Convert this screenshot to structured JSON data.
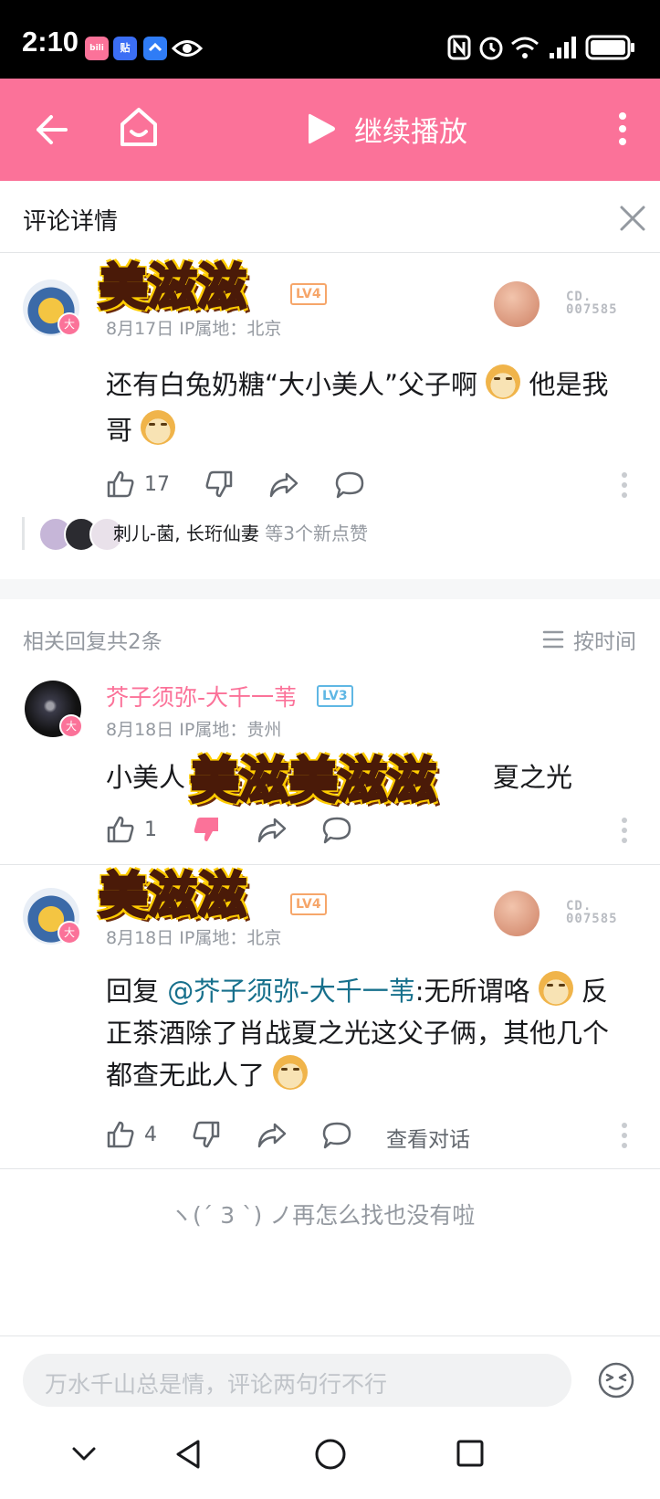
{
  "status_bar": {
    "time": "2:10",
    "apps": [
      "bilibili",
      "贴",
      "app-icon",
      "eye-icon"
    ]
  },
  "top_nav": {
    "continue_label": "继续播放"
  },
  "header": {
    "title": "评论详情"
  },
  "main_comment": {
    "username": "美滋滋",
    "level": "LV4",
    "meta": "8月17日  IP属地：北京",
    "text_1": "还有白兔奶糖“大小美人”父子啊",
    "text_2": "他是我",
    "text_3": "哥",
    "likes": "17",
    "liked_by": "刺儿-菌, 长珩仙妻",
    "liked_suffix": "等3个新点赞",
    "fan_badge_code_1": "CD.",
    "fan_badge_code_2": "007585"
  },
  "replies_header": {
    "count_label": "相关回复共2条",
    "sort_label": "按时间"
  },
  "replies": [
    {
      "username": "芥子须弥-大千一苇",
      "level": "LV3",
      "meta": "8月18日  IP属地：贵州",
      "text": "小美人",
      "text_end": "夏之光",
      "sticker": "美滋美滋滋",
      "likes": "1"
    },
    {
      "username": "美滋滋",
      "level": "LV4",
      "meta": "8月18日  IP属地：北京",
      "reply_prefix": "回复",
      "mention": "@芥子须弥-大千一苇",
      "text_1": ":无所谓咯",
      "text_2": "反",
      "text_3": "正茶酒除了肖战夏之光这父子俩，其他几个",
      "text_4": "都查无此人了",
      "likes": "4",
      "view_conversation": "查看对话",
      "fan_badge_code_1": "CD.",
      "fan_badge_code_2": "007585"
    }
  ],
  "footer": {
    "end_text": "ヽ(ˊ 3 ˋ) ノ再怎么找也没有啦"
  },
  "comment_input": {
    "placeholder": "万水千山总是情，评论两句行不行"
  },
  "colors": {
    "brand_pink": "#fb7299",
    "link_blue": "#17708c",
    "meta_gray": "#9499a0"
  }
}
